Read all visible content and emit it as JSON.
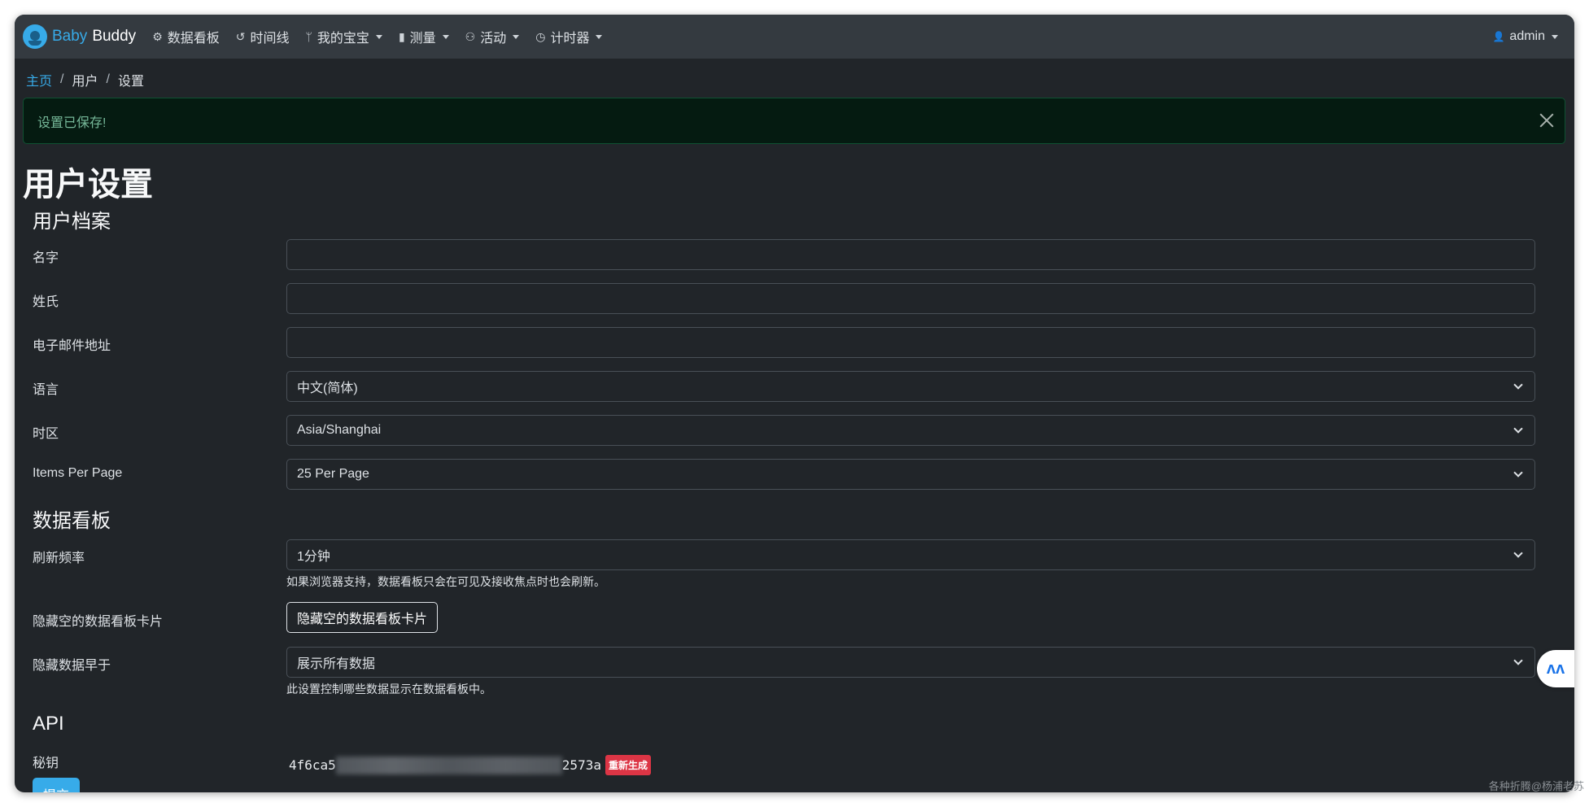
{
  "navbar": {
    "brand_part1": "Baby",
    "brand_part2": "Buddy",
    "items": [
      {
        "label": "数据看板",
        "icon": "dashboard-icon",
        "glyph": "⚙"
      },
      {
        "label": "时间线",
        "icon": "history-icon",
        "glyph": "↺"
      },
      {
        "label": "我的宝宝",
        "icon": "child-icon",
        "glyph": "ᛘ"
      },
      {
        "label": "测量",
        "icon": "clipboard-icon",
        "glyph": "▮"
      },
      {
        "label": "活动",
        "icon": "activities-icon",
        "glyph": "⚇"
      },
      {
        "label": "计时器",
        "icon": "timer-icon",
        "glyph": "◷"
      }
    ],
    "user": "admin",
    "user_icon_glyph": "👤"
  },
  "breadcrumb": {
    "home": "主页",
    "users": "用户",
    "current": "设置",
    "sep": "/"
  },
  "alert": {
    "message": "设置已保存!"
  },
  "page": {
    "title": "用户设置"
  },
  "profile": {
    "section": "用户档案",
    "first_name_label": "名字",
    "first_name_value": "",
    "last_name_label": "姓氏",
    "last_name_value": "",
    "email_label": "电子邮件地址",
    "email_value": "",
    "language_label": "语言",
    "language_value": "中文(简体)",
    "timezone_label": "时区",
    "timezone_value": "Asia/Shanghai",
    "items_per_page_label": "Items Per Page",
    "items_per_page_value": "25 Per Page"
  },
  "dashboard": {
    "section": "数据看板",
    "refresh_label": "刷新频率",
    "refresh_value": "1分钟",
    "refresh_help": "如果浏览器支持，数据看板只会在可见及接收焦点时也会刷新。",
    "hide_empty_label": "隐藏空的数据看板卡片",
    "hide_empty_button": "隐藏空的数据看板卡片",
    "hide_older_label": "隐藏数据早于",
    "hide_older_value": "展示所有数据",
    "hide_older_help": "此设置控制哪些数据显示在数据看板中。"
  },
  "api": {
    "section": "API",
    "key_label": "秘钥",
    "key_prefix": "4f6ca5",
    "key_suffix": "2573a",
    "regenerate": "重新生成"
  },
  "submit": {
    "label": "提交"
  },
  "side_badge_glyph": "ʌʌ",
  "watermark": "各种折腾@杨浦老苏",
  "colors": {
    "accent": "#37abe9",
    "background": "#212529",
    "navbar": "#343a40",
    "alert_bg": "#051b11",
    "alert_text": "#75b798",
    "danger": "#dc3545"
  }
}
